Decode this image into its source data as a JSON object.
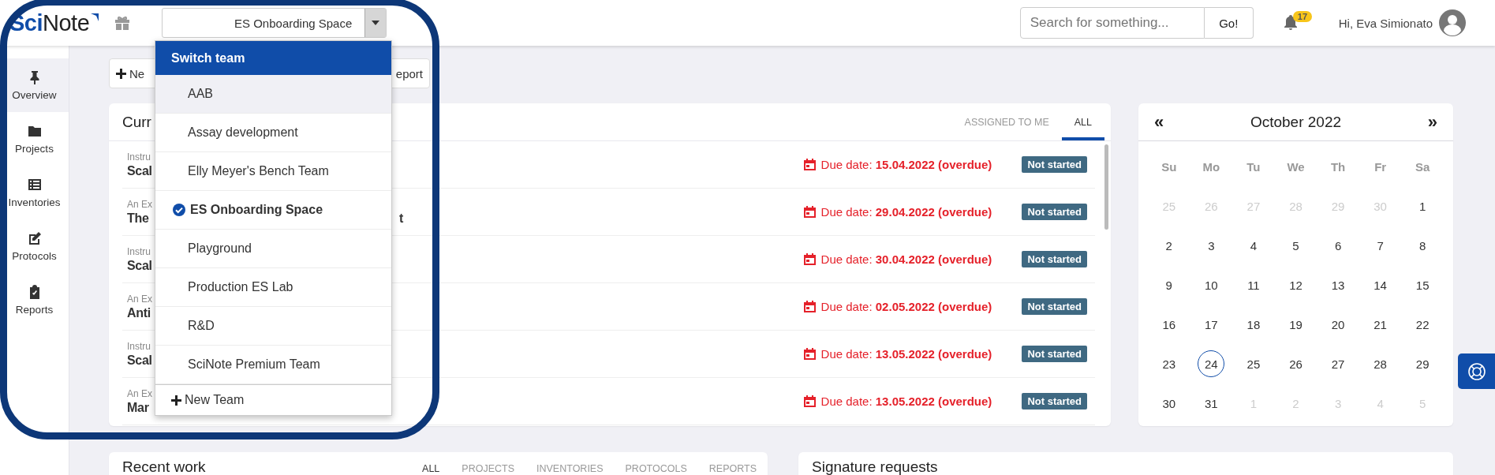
{
  "header": {
    "logo": "**Sci**Note",
    "team_select": "ES Onboarding Space",
    "search": {
      "placeholder": "Search for something...",
      "button": "Go!"
    },
    "notifications": {
      "count": "17"
    },
    "greeting": "Hi, Eva Simionato"
  },
  "sidebar": {
    "items": [
      {
        "label": "Overview",
        "selected": true
      },
      {
        "label": "Projects",
        "selected": false
      },
      {
        "label": "Inventories",
        "selected": false
      },
      {
        "label": "Protocols",
        "selected": false
      },
      {
        "label": "Reports",
        "selected": false
      }
    ]
  },
  "toolbar": {
    "buttons": [
      {
        "label": "Ne",
        "kind": "new"
      },
      {
        "label": "eport",
        "kind": "report"
      }
    ]
  },
  "current_tasks": {
    "title": "Curr",
    "tabs": [
      {
        "label": "ASSIGNED TO ME",
        "selected": false
      },
      {
        "label": "ALL",
        "selected": true
      }
    ],
    "rows": [
      {
        "project": "Instru",
        "title": "Scal",
        "due": "Due date: **15.04.2022 (overdue)**",
        "status": "Not started"
      },
      {
        "project": "An Ex",
        "title": "The",
        "title_tail": "t",
        "due": "Due date: **29.04.2022 (overdue)**",
        "status": "Not started"
      },
      {
        "project": "Instru",
        "title": "Scal",
        "due": "Due date: **30.04.2022 (overdue)**",
        "status": "Not started"
      },
      {
        "project": "An Ex",
        "title": "Anti",
        "due": "Due date: **02.05.2022 (overdue)**",
        "status": "Not started"
      },
      {
        "project": "Instru",
        "title": "Scal",
        "due": "Due date: **13.05.2022 (overdue)**",
        "status": "Not started"
      },
      {
        "project": "An Ex",
        "title": "Mar",
        "due": "Due date: **13.05.2022 (overdue)**",
        "status": "Not started"
      }
    ]
  },
  "team_dropdown": {
    "title": "Switch team",
    "teams": [
      {
        "name": "AAB",
        "selected": false,
        "hovered": true
      },
      {
        "name": "Assay development",
        "selected": false,
        "hovered": false
      },
      {
        "name": "Elly Meyer's Bench Team",
        "selected": false,
        "hovered": false
      },
      {
        "name": "ES Onboarding Space",
        "selected": true,
        "hovered": false
      },
      {
        "name": "Playground",
        "selected": false,
        "hovered": false
      },
      {
        "name": "Production ES Lab",
        "selected": false,
        "hovered": false
      },
      {
        "name": "R&D",
        "selected": false,
        "hovered": false
      },
      {
        "name": "SciNote Premium Team",
        "selected": false,
        "hovered": false
      }
    ],
    "new_team": "New Team"
  },
  "calendar": {
    "title": "October 2022",
    "prev": "«",
    "next": "»",
    "weekdays": [
      "Su",
      "Mo",
      "Tu",
      "We",
      "Th",
      "Fr",
      "Sa"
    ],
    "days": [
      {
        "day": "25",
        "outside": true,
        "today": false
      },
      {
        "day": "26",
        "outside": true,
        "today": false
      },
      {
        "day": "27",
        "outside": true,
        "today": false
      },
      {
        "day": "28",
        "outside": true,
        "today": false
      },
      {
        "day": "29",
        "outside": true,
        "today": false
      },
      {
        "day": "30",
        "outside": true,
        "today": false
      },
      {
        "day": "1",
        "outside": false,
        "today": false
      },
      {
        "day": "2",
        "outside": false,
        "today": false
      },
      {
        "day": "3",
        "outside": false,
        "today": false
      },
      {
        "day": "4",
        "outside": false,
        "today": false
      },
      {
        "day": "5",
        "outside": false,
        "today": false
      },
      {
        "day": "6",
        "outside": false,
        "today": false
      },
      {
        "day": "7",
        "outside": false,
        "today": false
      },
      {
        "day": "8",
        "outside": false,
        "today": false
      },
      {
        "day": "9",
        "outside": false,
        "today": false
      },
      {
        "day": "10",
        "outside": false,
        "today": false
      },
      {
        "day": "11",
        "outside": false,
        "today": false
      },
      {
        "day": "12",
        "outside": false,
        "today": false
      },
      {
        "day": "13",
        "outside": false,
        "today": false
      },
      {
        "day": "14",
        "outside": false,
        "today": false
      },
      {
        "day": "15",
        "outside": false,
        "today": false
      },
      {
        "day": "16",
        "outside": false,
        "today": false
      },
      {
        "day": "17",
        "outside": false,
        "today": false
      },
      {
        "day": "18",
        "outside": false,
        "today": false
      },
      {
        "day": "19",
        "outside": false,
        "today": false
      },
      {
        "day": "20",
        "outside": false,
        "today": false
      },
      {
        "day": "21",
        "outside": false,
        "today": false
      },
      {
        "day": "22",
        "outside": false,
        "today": false
      },
      {
        "day": "23",
        "outside": false,
        "today": false
      },
      {
        "day": "24",
        "outside": false,
        "today": true
      },
      {
        "day": "25",
        "outside": false,
        "today": false
      },
      {
        "day": "26",
        "outside": false,
        "today": false
      },
      {
        "day": "27",
        "outside": false,
        "today": false
      },
      {
        "day": "28",
        "outside": false,
        "today": false
      },
      {
        "day": "29",
        "outside": false,
        "today": false
      },
      {
        "day": "30",
        "outside": false,
        "today": false
      },
      {
        "day": "31",
        "outside": false,
        "today": false
      },
      {
        "day": "1",
        "outside": true,
        "today": false
      },
      {
        "day": "2",
        "outside": true,
        "today": false
      },
      {
        "day": "3",
        "outside": true,
        "today": false
      },
      {
        "day": "4",
        "outside": true,
        "today": false
      },
      {
        "day": "5",
        "outside": true,
        "today": false
      }
    ]
  },
  "recent_work": {
    "title": "Recent work",
    "tabs": [
      {
        "label": "ALL",
        "selected": true
      },
      {
        "label": "PROJECTS",
        "selected": false
      },
      {
        "label": "INVENTORIES",
        "selected": false
      },
      {
        "label": "PROTOCOLS",
        "selected": false
      },
      {
        "label": "REPORTS",
        "selected": false
      }
    ]
  },
  "signature_requests": {
    "title": "Signature requests"
  }
}
